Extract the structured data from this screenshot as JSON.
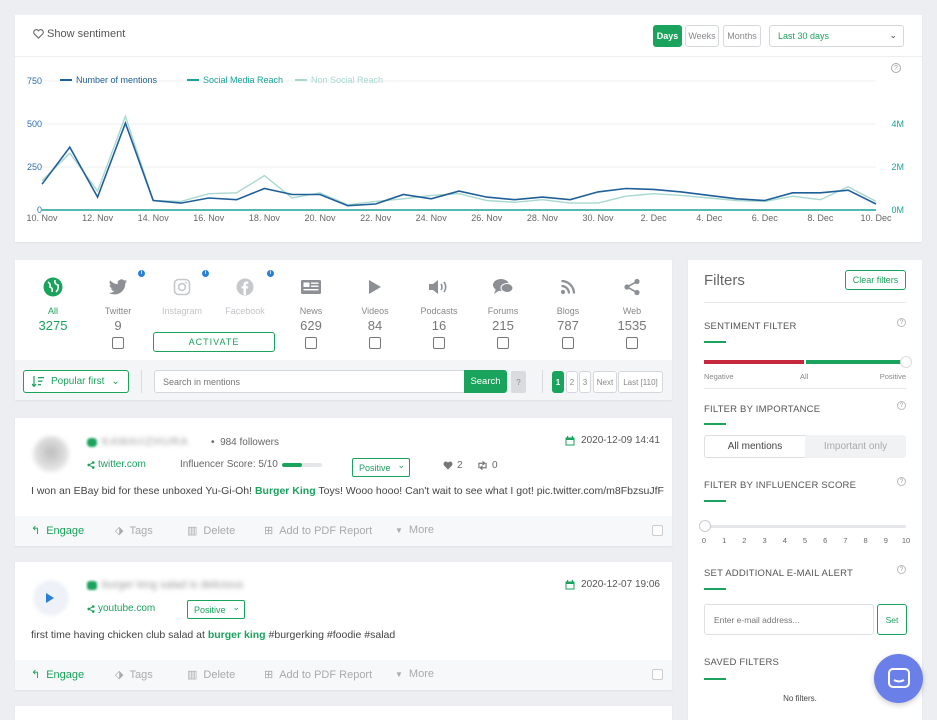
{
  "chart_section": {
    "sentiment_label": "Show sentiment",
    "period_buttons": [
      "Days",
      "Weeks",
      "Months"
    ],
    "active_period": "Days",
    "range_select": "Last 30 days",
    "help": "?"
  },
  "chart_data": {
    "type": "line",
    "legend_position": "top-left",
    "x": [
      "10. Nov",
      "11. Nov",
      "12. Nov",
      "13. Nov",
      "14. Nov",
      "15. Nov",
      "16. Nov",
      "17. Nov",
      "18. Nov",
      "19. Nov",
      "20. Nov",
      "21. Nov",
      "22. Nov",
      "23. Nov",
      "24. Nov",
      "25. Nov",
      "26. Nov",
      "27. Nov",
      "28. Nov",
      "29. Nov",
      "30. Nov",
      "1. Dec",
      "2. Dec",
      "3. Dec",
      "4. Dec",
      "5. Dec",
      "6. Dec",
      "7. Dec",
      "8. Dec",
      "9. Dec",
      "10. Dec"
    ],
    "x_tick_labels": [
      "10. Nov",
      "12. Nov",
      "14. Nov",
      "16. Nov",
      "18. Nov",
      "20. Nov",
      "22. Nov",
      "24. Nov",
      "26. Nov",
      "28. Nov",
      "30. Nov",
      "2. Dec",
      "4. Dec",
      "6. Dec",
      "8. Dec",
      "10. Dec"
    ],
    "y_left_ticks": [
      "0",
      "250",
      "500",
      "750"
    ],
    "y_right_ticks": [
      "0M",
      "2M",
      "4M"
    ],
    "ylim_left": [
      0,
      750
    ],
    "ylim_right": [
      0,
      6
    ],
    "grid": true,
    "series": [
      {
        "name": "Number of mentions",
        "axis": "left",
        "color": "#1f5f9a",
        "values": [
          150,
          365,
          75,
          505,
          55,
          40,
          70,
          60,
          125,
          90,
          90,
          25,
          35,
          90,
          65,
          110,
          75,
          60,
          75,
          60,
          105,
          125,
          120,
          105,
          85,
          65,
          55,
          100,
          100,
          115,
          35
        ]
      },
      {
        "name": "Social Media Reach",
        "axis": "right",
        "color": "#1aa39a",
        "values": [
          0,
          0,
          0,
          0,
          0,
          0,
          0,
          0,
          0,
          0,
          0,
          0,
          0,
          0,
          0,
          0,
          0,
          0,
          0,
          0,
          0,
          0,
          0,
          0,
          0,
          0,
          0,
          0,
          0,
          0,
          0
        ]
      },
      {
        "name": "Non Social Reach",
        "axis": "left",
        "color": "#a8d8cf",
        "values": [
          170,
          330,
          110,
          545,
          55,
          50,
          95,
          100,
          200,
          70,
          100,
          30,
          50,
          65,
          85,
          95,
          55,
          45,
          60,
          40,
          40,
          80,
          95,
          85,
          70,
          55,
          50,
          80,
          60,
          135,
          50
        ]
      }
    ]
  },
  "sources": [
    {
      "name": "All",
      "count": "3275",
      "icon": "globe-icon",
      "active": true
    },
    {
      "name": "Twitter",
      "count": "9",
      "icon": "twitter-icon"
    },
    {
      "name": "Instagram",
      "count": "",
      "icon": "instagram-icon"
    },
    {
      "name": "Facebook",
      "count": "",
      "icon": "facebook-icon"
    },
    {
      "name": "News",
      "count": "629",
      "icon": "news-icon"
    },
    {
      "name": "Videos",
      "count": "84",
      "icon": "play-icon"
    },
    {
      "name": "Podcasts",
      "count": "16",
      "icon": "speaker-icon"
    },
    {
      "name": "Forums",
      "count": "215",
      "icon": "forum-icon"
    },
    {
      "name": "Blogs",
      "count": "787",
      "icon": "rss-icon"
    },
    {
      "name": "Web",
      "count": "1535",
      "icon": "share-icon"
    }
  ],
  "activate_label": "ACTIVATE",
  "toolbar": {
    "sort_label": "Popular first",
    "search_placeholder": "Search in mentions",
    "search_button": "Search",
    "help": "?",
    "pages": [
      "1",
      "2",
      "3"
    ],
    "next": "Next",
    "last": "Last [110]"
  },
  "mentions": [
    {
      "author": "KAWAIIZHURA",
      "followers": "984 followers",
      "date": "2020-12-09 14:41",
      "source": "twitter.com",
      "influencer": "Influencer Score: 5/10",
      "influencer_level": 0.5,
      "sentiment": "Positive",
      "likes": "2",
      "retweets": "0",
      "text_before": "I won an EBay bid for these unboxed Yu-Gi-Oh! ",
      "highlight": "Burger King",
      "text_after": " Toys! Wooo hooo! Can't wait to see what I got! pic.twitter.com/m8FbzsuJfF"
    },
    {
      "author": "burger king salad is delicious",
      "date": "2020-12-07 19:06",
      "source": "youtube.com",
      "sentiment": "Positive",
      "text_before": "first time having chicken club salad at ",
      "highlight": "burger king",
      "text_after": " #burgerking #foodie #salad"
    }
  ],
  "actions": {
    "engage": "Engage",
    "tags": "Tags",
    "delete": "Delete",
    "pdf": "Add to PDF Report",
    "more": "More"
  },
  "filters": {
    "title": "Filters",
    "clear": "Clear filters",
    "sentiment_title": "SENTIMENT FILTER",
    "sentiment_labels": [
      "Negative",
      "All",
      "Positive"
    ],
    "importance_title": "FILTER BY IMPORTANCE",
    "importance_options": [
      "All mentions",
      "Important only"
    ],
    "influencer_title": "FILTER BY INFLUENCER SCORE",
    "influencer_ticks": [
      "0",
      "1",
      "2",
      "3",
      "4",
      "5",
      "6",
      "7",
      "8",
      "9",
      "10"
    ],
    "email_title": "SET ADDITIONAL E-MAIL ALERT",
    "email_placeholder": "Enter e-mail address...",
    "email_button": "Set",
    "saved_title": "SAVED FILTERS",
    "no_filters": "No filters.",
    "help": "?"
  }
}
